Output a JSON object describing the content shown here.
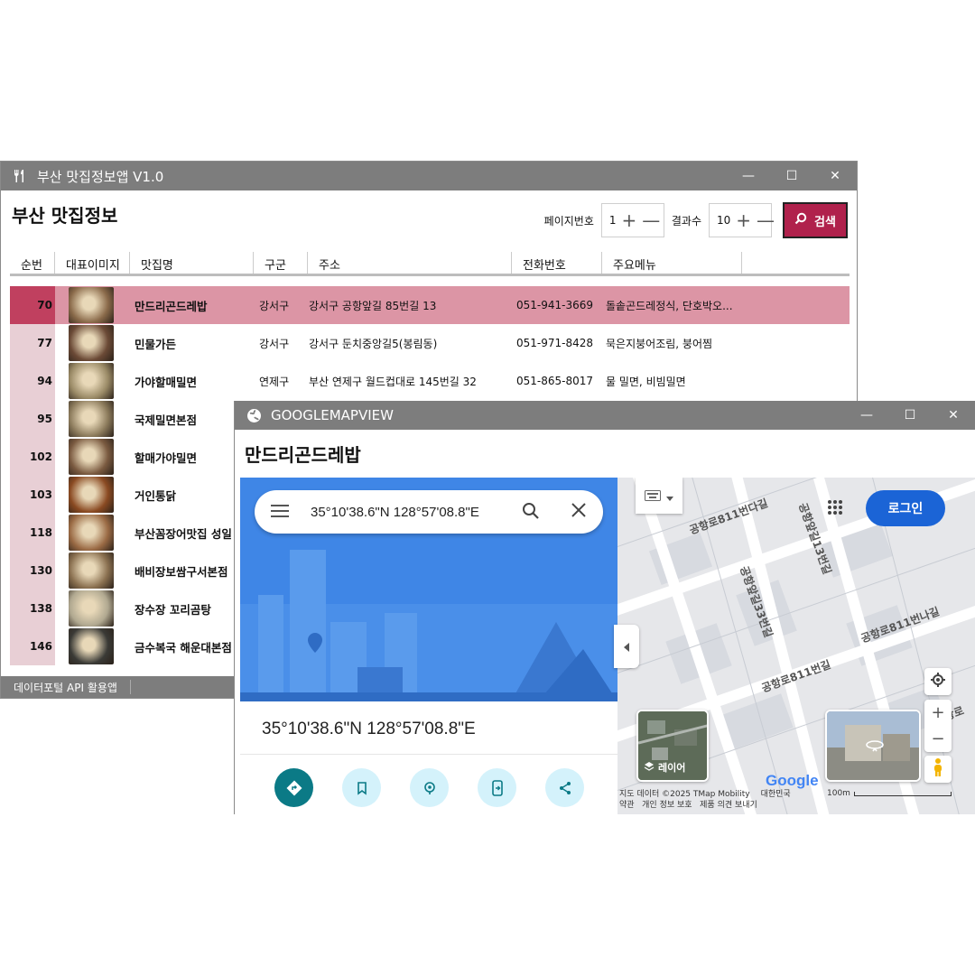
{
  "main_window": {
    "title": "부산 맛집정보앱 V1.0",
    "heading": "부산 맛집정보",
    "page_label": "페이지번호",
    "page_value": "1",
    "results_label": "결과수",
    "results_value": "10",
    "search_label": "검색",
    "columns": [
      "순번",
      "대표이미지",
      "맛집명",
      "구군",
      "주소",
      "전화번호",
      "주요메뉴"
    ],
    "rows": [
      {
        "no": "70",
        "name": "만드리곤드레밥",
        "gu": "강서구",
        "addr": "강서구 공항앞길 85번길 13",
        "tel": "051-941-3669",
        "menu": "돌솥곤드레정식, 단호박오...",
        "img": "#8a6a4a"
      },
      {
        "no": "77",
        "name": "민물가든",
        "gu": "강서구",
        "addr": "강서구 둔치중앙길5(봉림동)",
        "tel": "051-971-8428",
        "menu": "묵은지붕어조림, 붕어찜",
        "img": "#6b4a36"
      },
      {
        "no": "94",
        "name": "가야할매밀면",
        "gu": "연제구",
        "addr": "부산 연제구 월드컵대로 145번길 32",
        "tel": "051-865-8017",
        "menu": "물 밀면, 비빔밀면",
        "img": "#9a8a66"
      },
      {
        "no": "95",
        "name": "국제밀면본점",
        "gu": "",
        "addr": "",
        "tel": "",
        "menu": "",
        "img": "#8c7b5c"
      },
      {
        "no": "102",
        "name": "할매가야밀면",
        "gu": "",
        "addr": "",
        "tel": "",
        "menu": "",
        "img": "#7a5a40"
      },
      {
        "no": "103",
        "name": "거인통닭",
        "gu": "",
        "addr": "",
        "tel": "",
        "menu": "",
        "img": "#8a4a22"
      },
      {
        "no": "118",
        "name": "부산꼼장어맛집 성일",
        "gu": "",
        "addr": "",
        "tel": "",
        "menu": "",
        "img": "#9a6a44"
      },
      {
        "no": "130",
        "name": "배비장보쌈구서본점",
        "gu": "",
        "addr": "",
        "tel": "",
        "menu": "",
        "img": "#8a7050"
      },
      {
        "no": "138",
        "name": "장수장 꼬리곰탕",
        "gu": "",
        "addr": "",
        "tel": "",
        "menu": "",
        "img": "#b0a890"
      },
      {
        "no": "146",
        "name": "금수복국 해운대본점",
        "gu": "",
        "addr": "",
        "tel": "",
        "menu": "",
        "img": "#3a3a36"
      }
    ],
    "status": "데이터포털 API 활용앱"
  },
  "map_window": {
    "title": "GOOGLEMAPVIEW",
    "heading": "만드리곤드레밥",
    "search_query": "35°10'38.6\"N 128°57'08.8\"E",
    "coord_title": "35°10'38.6\"N 128°57'08.8\"E",
    "login": "로그인",
    "layer_label": "레이어",
    "google": "Google",
    "attribution": "지도 데이터 ©2025 TMap Mobility",
    "country": "대한민국",
    "terms": "약관",
    "privacy": "개인 정보 보호",
    "feedback": "제품 의견 보내기",
    "scale": "100m",
    "streets": [
      "공항로811번다길",
      "공항앞길33번길",
      "공항로811번나길",
      "공항로811번길",
      "공항앞길13번길",
      "공항로"
    ]
  },
  "colors": {
    "titlebar": "#7d7d7d",
    "accent": "#b0214c",
    "selected_row": "#dc95a5",
    "number_cell": "#e8cfd5",
    "map_primary": "#1b64d6"
  }
}
